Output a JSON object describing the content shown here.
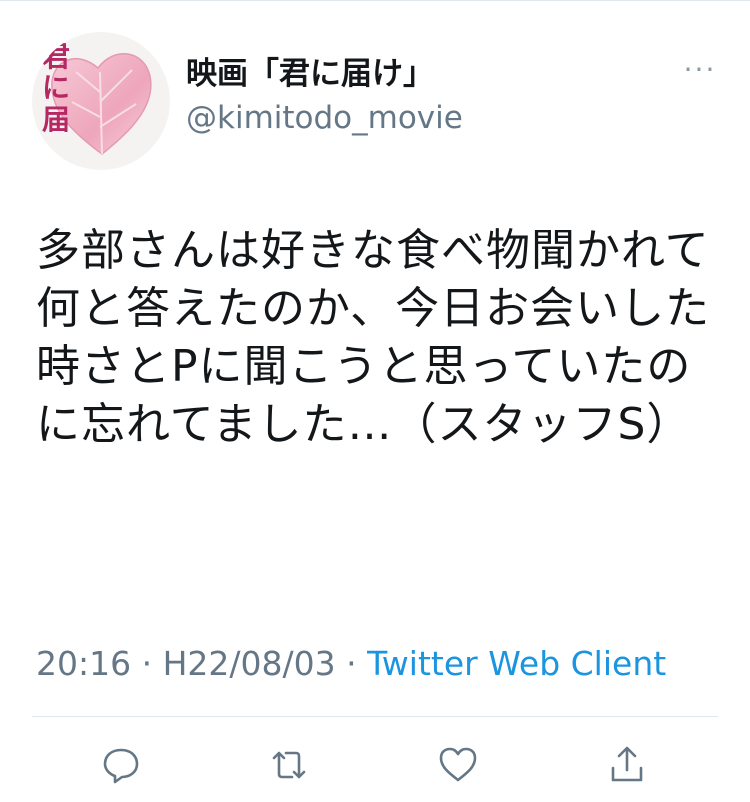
{
  "account": {
    "display_name": "映画「君に届け」",
    "handle": "@kimitodo_movie",
    "avatar_text": "君に届け"
  },
  "more": {
    "label": "···"
  },
  "tweet": {
    "text": "多部さんは好きな食べ物聞かれて何と答えたのか、今日お会いした時さとPに聞こうと思っていたのに忘れてました…（スタッフS）"
  },
  "meta": {
    "time": "20:16",
    "separator1": " · ",
    "date": "H22/08/03",
    "separator2": " · ",
    "client": "Twitter Web Client"
  },
  "actions": [
    {
      "name": "reply",
      "icon": "reply-icon"
    },
    {
      "name": "retweet",
      "icon": "retweet-icon"
    },
    {
      "name": "like",
      "icon": "heart-icon"
    },
    {
      "name": "share",
      "icon": "share-icon"
    }
  ],
  "colors": {
    "text": "#14171a",
    "secondary": "#657786",
    "link": "#1b95e0",
    "icon": "#657786",
    "avatar_accent": "#b52864",
    "heart_pink": "#f2b5c8"
  }
}
